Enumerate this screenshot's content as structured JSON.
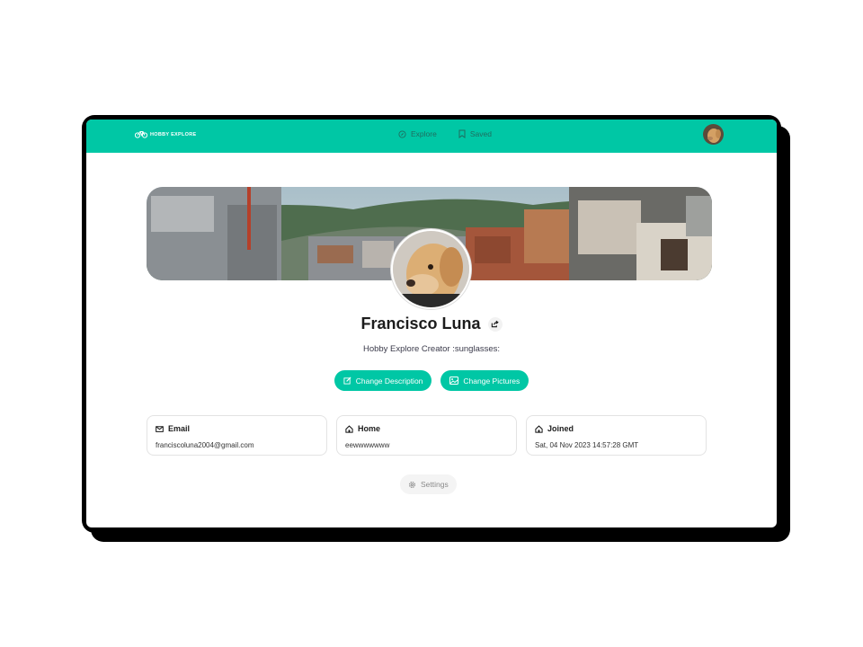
{
  "brand": {
    "name": "HOBBY EXPLORE",
    "color": "#00c7a5"
  },
  "nav": {
    "links": [
      {
        "label": "Explore",
        "icon": "compass-icon"
      },
      {
        "label": "Saved",
        "icon": "bookmark-icon"
      }
    ]
  },
  "profile": {
    "name": "Francisco Luna",
    "description": "Hobby Explore Creator :sunglasses:",
    "buttons": {
      "change_description": "Change Description",
      "change_pictures": "Change Pictures"
    }
  },
  "cards": [
    {
      "title": "Email",
      "icon": "envelope-icon",
      "value": "franciscoluna2004@gmail.com"
    },
    {
      "title": "Home",
      "icon": "home-icon",
      "value": "eewwwwwww"
    },
    {
      "title": "Joined",
      "icon": "home-icon",
      "value": "Sat, 04 Nov 2023 14:57:28 GMT"
    }
  ],
  "settings_label": "Settings"
}
